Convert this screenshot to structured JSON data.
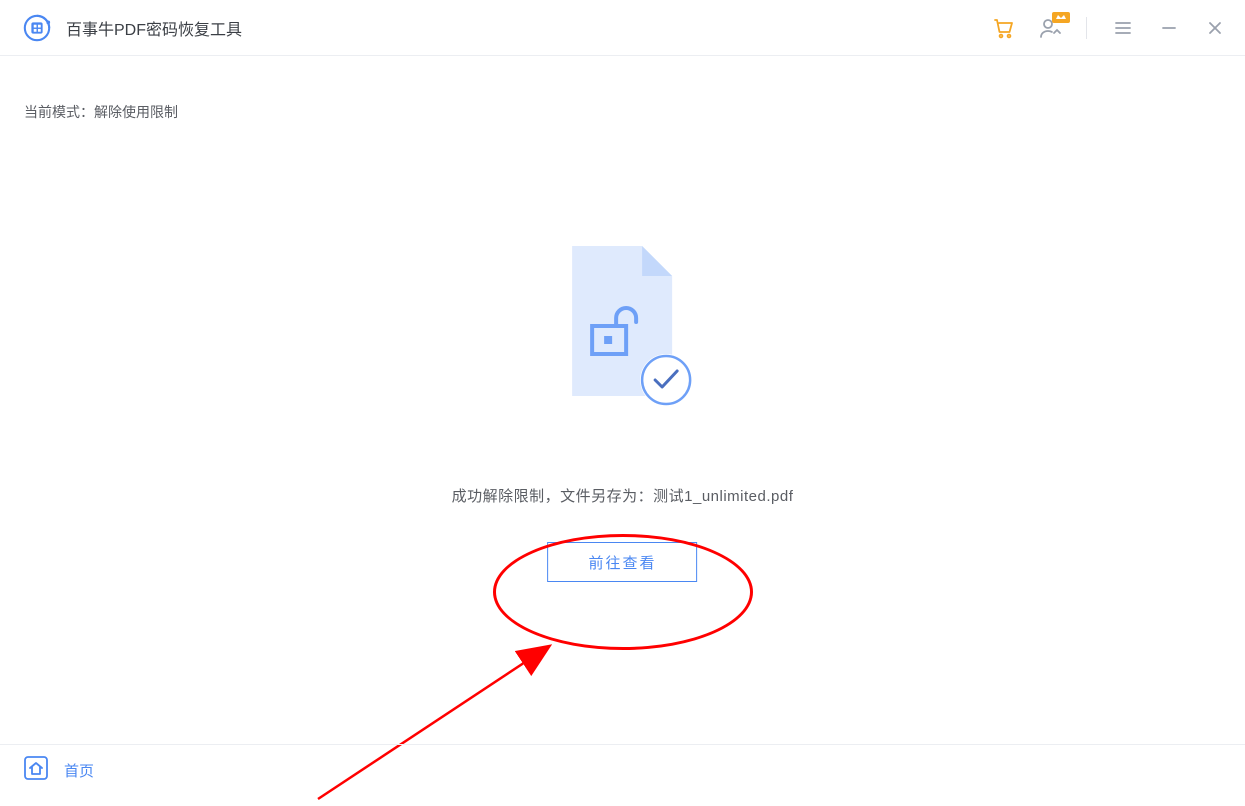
{
  "header": {
    "app_title": "百事牛PDF密码恢复工具"
  },
  "mode": {
    "label": "当前模式：",
    "value": "解除使用限制"
  },
  "result": {
    "message_prefix": "成功解除限制，文件另存为：",
    "filename": "测试1_unlimited.pdf",
    "view_button": "前往查看"
  },
  "footer": {
    "home": "首页"
  },
  "colors": {
    "accent": "#4a87f2",
    "orange": "#f5a623",
    "iconGrey": "#9aa1ad",
    "annotation": "#ff0000"
  }
}
